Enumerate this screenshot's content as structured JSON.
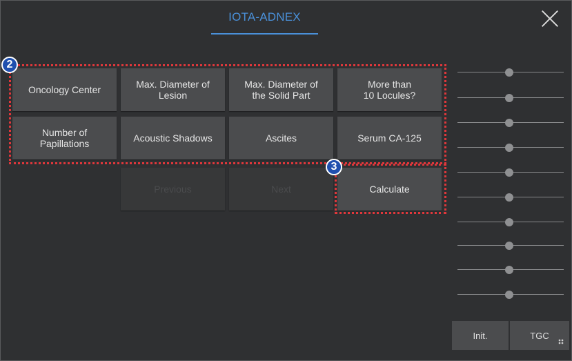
{
  "header": {
    "title": "IOTA-ADNEX",
    "close_icon": "close-icon"
  },
  "badges": {
    "parameters": "2",
    "calculate": "3",
    "color": "#1f4fae"
  },
  "highlight_color": "#e0373b",
  "parameters": {
    "row1": [
      "Oncology Center",
      "Max. Diameter of\nLesion",
      "Max. Diameter of\nthe Solid Part",
      "More than\n10 Locules?"
    ],
    "row2": [
      "Number of\nPapillations",
      "Acoustic Shadows",
      "Ascites",
      "Serum CA-125"
    ]
  },
  "navigation": {
    "previous_label": "Previous",
    "next_label": "Next",
    "calculate_label": "Calculate"
  },
  "tgc_panel": {
    "slider_count": 10,
    "init_label": "Init.",
    "tgc_label": "TGC"
  },
  "colors": {
    "accent": "#4a90d9",
    "panel_bg": "#2f3032",
    "button_bg": "#4b4c4e"
  }
}
